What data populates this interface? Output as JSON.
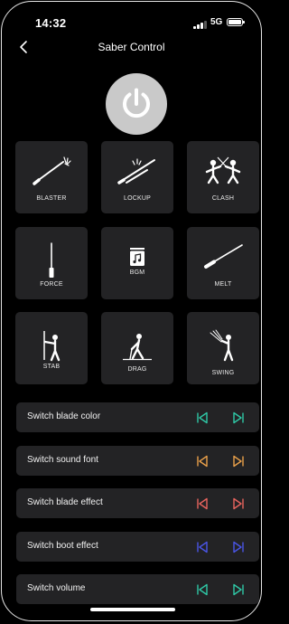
{
  "status": {
    "time": "14:32",
    "network": "5G"
  },
  "header": {
    "title": "Saber Control"
  },
  "colors": {
    "background": "#000000",
    "tile": "#232325",
    "power": "#c9c9c9",
    "teal": "#2fc8a6",
    "orange": "#e9a04a",
    "coral": "#e8645e",
    "blue": "#4a55e6"
  },
  "actions": [
    {
      "id": "blaster",
      "label": "BLASTER",
      "icon": "blaster-icon"
    },
    {
      "id": "lockup",
      "label": "LOCKUP",
      "icon": "lockup-icon"
    },
    {
      "id": "clash",
      "label": "CLASH",
      "icon": "clash-icon"
    },
    {
      "id": "force",
      "label": "FORCE",
      "icon": "force-icon"
    },
    {
      "id": "bgm",
      "label": "BGM",
      "icon": "music-icon"
    },
    {
      "id": "melt",
      "label": "MELT",
      "icon": "melt-icon"
    },
    {
      "id": "stab",
      "label": "STAB",
      "icon": "stab-icon"
    },
    {
      "id": "drag",
      "label": "DRAG",
      "icon": "drag-icon"
    },
    {
      "id": "swing",
      "label": "SWING",
      "icon": "swing-icon"
    }
  ],
  "switches": [
    {
      "label": "Switch blade color",
      "color": "#2fc8a6"
    },
    {
      "label": "Switch sound font",
      "color": "#e9a04a"
    },
    {
      "label": "Switch blade effect",
      "color": "#e8645e"
    },
    {
      "label": "Switch boot effect",
      "color": "#4a55e6"
    },
    {
      "label": "Switch volume",
      "color": "#2fc8a6"
    }
  ]
}
